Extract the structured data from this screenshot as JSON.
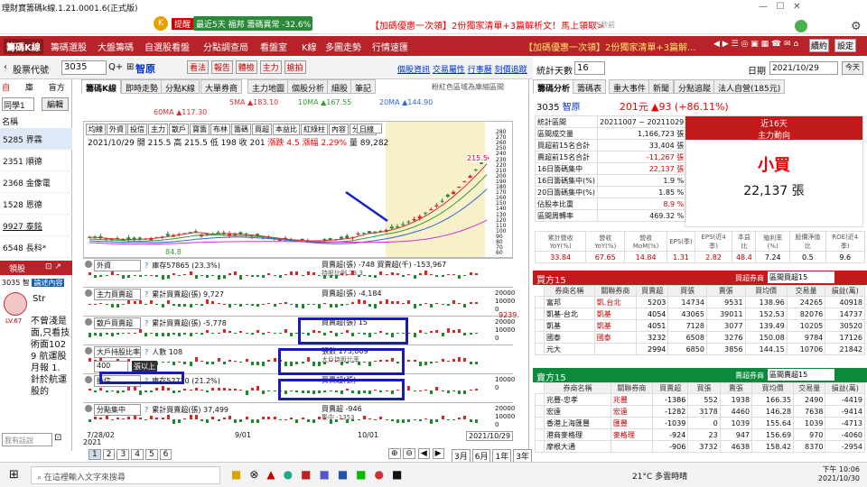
{
  "app": {
    "title": "理財寶籌碼k線.1.21.0001.6(正式版)",
    "promo": "最近5天 福邦 籌碼異常 -32.6%",
    "promo_tag": "提醒",
    "headline": "【加碼優惠一次領】2份獨家清單+3篇解析文！馬上領取>",
    "minutes": "35秒前"
  },
  "menu": {
    "brand": "籌碼K線",
    "items": [
      "籌碼選股",
      "大盤籌碼",
      "自選股看盤",
      "分點調查局",
      "看盤室",
      "K線",
      "多圖走勢",
      "行情速匯"
    ],
    "ticker": "【加碼優惠一次領】2份獨家清單+3篇解...",
    "renew": "續約",
    "settings": "設定"
  },
  "left": {
    "title": "股票代號",
    "code": "3035",
    "stock": "智原",
    "tools": [
      "看法",
      "報告",
      "體檢",
      "主力",
      "搶拍"
    ],
    "tabs": [
      "自",
      "庫",
      "盲方"
    ],
    "group": "同學1",
    "edit": "編輯",
    "colhdr": "名稱",
    "stocks": [
      "5285 界霖",
      "2351 順德",
      "2368 金像電",
      "1528 恩德",
      "9927 泰銘",
      "6548 長科*"
    ],
    "chat_tabs": [
      "領股",
      "論述內容"
    ],
    "chat_code": "3035 智",
    "user": "Str",
    "level": "LV.67",
    "post": "不曾淺是面,只看技術面1029 航運股月報 1. 針於航運股的",
    "input_placeholder": "我有話說"
  },
  "links": [
    "個股資訊",
    "交易屬性",
    "行事曆",
    "刻價追蹤"
  ],
  "charttabs": [
    "籌碼K線",
    "即時走勢",
    "分點K線",
    "大單券商",
    "主力地圖",
    "個股分析",
    "細股",
    "筆記"
  ],
  "chartnote": "粉紅色區域為庫縮區間",
  "ma": {
    "ma5": "5MA ▲183.10",
    "ma10": "10MA ▲167.55",
    "ma20": "20MA ▲144.90",
    "ma60": "60MA ▲117.30"
  },
  "indicators": [
    "均線",
    "外資",
    "投信",
    "主力",
    "散戶",
    "寶籌",
    "布林",
    "籌碼",
    "買超",
    "本益比",
    "紅綠柱",
    "內容",
    "分價量"
  ],
  "indicator_sel": "日線",
  "quote": "2021/10/29 開 215.5 高 215.5 低 198 收 201",
  "change": "漲跌 4.5",
  "pct": "漲幅 2.29%",
  "volume": "量 89,282",
  "price_labels": [
    "280",
    "270",
    "260",
    "250",
    "240",
    "230",
    "220",
    "210",
    "200",
    "190",
    "180",
    "170",
    "160",
    "150",
    "140",
    "130",
    "120",
    "110",
    "100",
    "90",
    "80",
    "70",
    "60"
  ],
  "last_price": "215.5",
  "low_mark": "84.8",
  "subs": [
    {
      "name": "外資",
      "legend": "庫存57865 (23.3%)",
      "legend2": "買賣超(張) -748 買賣超(千) -153,967",
      "legend3": "持股比例 23.3",
      "ax": [
        "",
        "",
        ""
      ]
    },
    {
      "name": "主力買賣超",
      "legend": "累計買賣超(張) 9,727",
      "legend2": "買賣超(張) -4,184",
      "ax": [
        "20000",
        "10000",
        "0"
      ]
    },
    {
      "name": "散戶買賣超",
      "legend": "累計買賣超(張) -5,778",
      "legend2": "買賣超(張) 15",
      "ax": [
        "20000",
        "10000",
        "0"
      ],
      "side": "9239."
    },
    {
      "name": "大戶持股比率",
      "legend": "人數 108",
      "legend2": "張數 173,009",
      "legend3": "大戶持股比率",
      "ax": [
        "",
        "",
        ""
      ]
    },
    {
      "name": "投信",
      "legend": "庫存52720 (21.2%)",
      "legend2": "買賣超(張)",
      "ax": [
        "10000",
        "0"
      ]
    },
    {
      "name": "分點集中",
      "legend": "累計買賣超(張) 37,499",
      "legend2": "買賣超 -946",
      "legend3": "集中 -1353",
      "ax": [
        "20000",
        "10000",
        "0"
      ]
    }
  ],
  "threshold": {
    "value": "400",
    "label": "張以上"
  },
  "sub_btn": "指標",
  "dates": [
    "7/28/02",
    "9/01",
    "10/01",
    "2021/10/29"
  ],
  "year": "2021",
  "pages": [
    "1",
    "2",
    "3",
    "4",
    "5",
    "6"
  ],
  "periods": [
    "3月",
    "6月",
    "1年",
    "3年"
  ],
  "period_sel": "3年",
  "close_label": "查詢",
  "right": {
    "stat_label": "統計天數",
    "days": "16",
    "date_label": "日期",
    "date": "2021/10/29",
    "today": "今天",
    "tabs": [
      "籌碼分析",
      "籌碼表",
      "重大事件",
      "新聞",
      "分點追蹤",
      "法人自營(185元)"
    ],
    "code": "3035",
    "name": "智原",
    "price": "201元",
    "chg": "▲93 (+86.11%)",
    "rows": [
      [
        "統計區間",
        "20211007 ~ 20211029"
      ],
      [
        "區間成交量",
        "1,166,723 張"
      ],
      [
        "買超前15名合計",
        "33,404 張"
      ],
      [
        "賣超前15名合計",
        "-11,267 張"
      ],
      [
        "16日籌碼集中",
        "22,137 張"
      ],
      [
        "16日籌碼集中(%)",
        "1.9 %"
      ],
      [
        "20日籌碼集中(%)",
        "1.85 %"
      ],
      [
        "佔股本比重",
        "8.9 %"
      ],
      [
        "區間周轉率",
        "469.32 %"
      ]
    ],
    "box_title": "近16天",
    "box_sub": "主力動向",
    "box_big": "小買",
    "box_val": "22,137 張",
    "fund_hdr": [
      "累計營收YoY(%)",
      "營收YoY(%)",
      "營收MoM(%)",
      "EPS(季)",
      "EPS(近4季)",
      "本益比",
      "殖利率(%)",
      "股價淨值比",
      "ROE(近4季)"
    ],
    "fund_val": [
      "33.84",
      "67.65",
      "14.84",
      "1.31",
      "2.82",
      "48.4",
      "7.24",
      "0.5",
      "9.6"
    ],
    "buy_title": "買方15",
    "buy_sel": "區間買超15",
    "buy_sel_label": "買超券商",
    "buy_hdr": [
      "券商名稱",
      "關聯券商",
      "買賣超",
      "買張",
      "賣張",
      "買均價",
      "交易量",
      "損益(萬)"
    ],
    "buy_rows": [
      [
        "富邦",
        "凱.台北",
        "5203",
        "14734",
        "9531",
        "138.96",
        "24265",
        "40918"
      ],
      [
        "凱基-台北",
        "凱基",
        "4054",
        "43065",
        "39011",
        "152.53",
        "82076",
        "14737"
      ],
      [
        "凱基",
        "凱基",
        "4051",
        "7128",
        "3077",
        "139.49",
        "10205",
        "30520"
      ],
      [
        "國泰",
        "國泰",
        "3232",
        "6508",
        "3276",
        "150.08",
        "9784",
        "17126"
      ],
      [
        "元大",
        "",
        "2994",
        "6850",
        "3856",
        "144.15",
        "10706",
        "21842"
      ]
    ],
    "sell_title": "賣方15",
    "sell_sel": "區間賣超15",
    "sell_sel_label": "賣超券商",
    "sell_hdr": [
      "券商名稱",
      "關聯券商",
      "買賣超",
      "買張",
      "賣張",
      "買均價",
      "交易量",
      "損益(萬)"
    ],
    "sell_rows": [
      [
        "兆豐-忠孝",
        "兆豐",
        "-1386",
        "552",
        "1938",
        "166.35",
        "2490",
        "-4419"
      ],
      [
        "宏遠",
        "宏遠",
        "-1282",
        "3178",
        "4460",
        "146.28",
        "7638",
        "-9414"
      ],
      [
        "香港上海匯豐",
        "匯豐",
        "-1039",
        "0",
        "1039",
        "155.64",
        "1039",
        "-4713"
      ],
      [
        "港商麥格理",
        "麥格理",
        "-924",
        "23",
        "947",
        "156.69",
        "970",
        "-4060"
      ],
      [
        "摩根大通",
        "",
        "-906",
        "3732",
        "4638",
        "158.42",
        "8370",
        "-2954"
      ]
    ]
  },
  "task": {
    "search": "在這裡輸入文字來搜尋",
    "weather": "21°C 多雲時晴",
    "time": "下午 10:06",
    "date": "2021/10/30"
  }
}
